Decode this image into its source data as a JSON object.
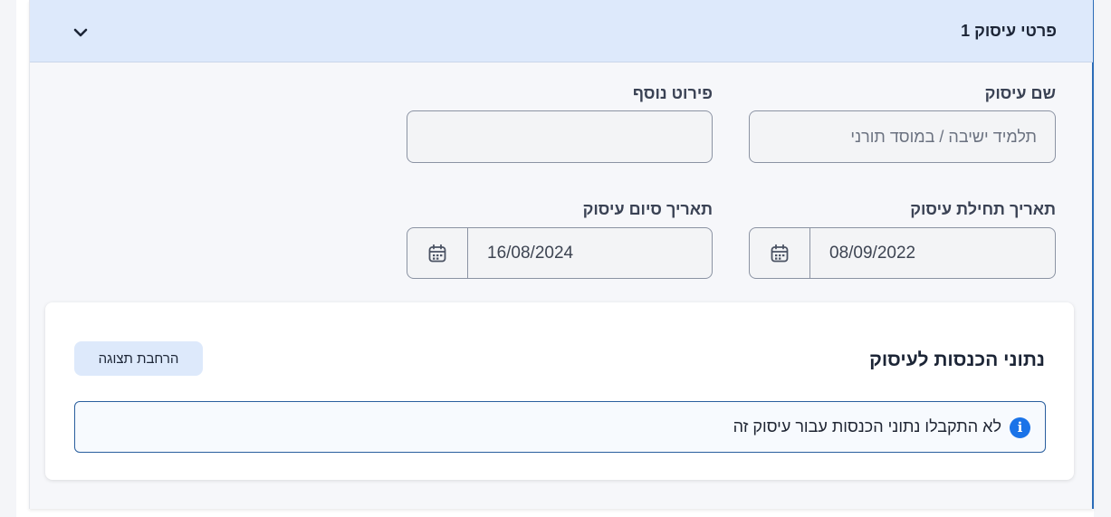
{
  "section": {
    "title": "פרטי עיסוק 1",
    "collapse_icon": "chevron-down-icon"
  },
  "fields": {
    "occupation_name": {
      "label": "שם עיסוק",
      "placeholder": "תלמיד ישיבה / במוסד תורני",
      "value": ""
    },
    "additional_details": {
      "label": "פירוט נוסף",
      "value": ""
    },
    "start_date": {
      "label": "תאריך תחילת עיסוק",
      "value": "08/09/2022",
      "icon": "calendar-icon"
    },
    "end_date": {
      "label": "תאריך סיום עיסוק",
      "value": "16/08/2024",
      "icon": "calendar-icon"
    }
  },
  "income_card": {
    "title": "נתוני הכנסות לעיסוק",
    "expand_button": "הרחבת תצוגה",
    "info_icon": "info-icon",
    "info_message": "לא התקבלו נתוני הכנסות עבור עיסוק זה"
  },
  "colors": {
    "header_bg": "#dde9fb",
    "accent": "#2b6cb8",
    "info_icon": "#1a73e8"
  }
}
